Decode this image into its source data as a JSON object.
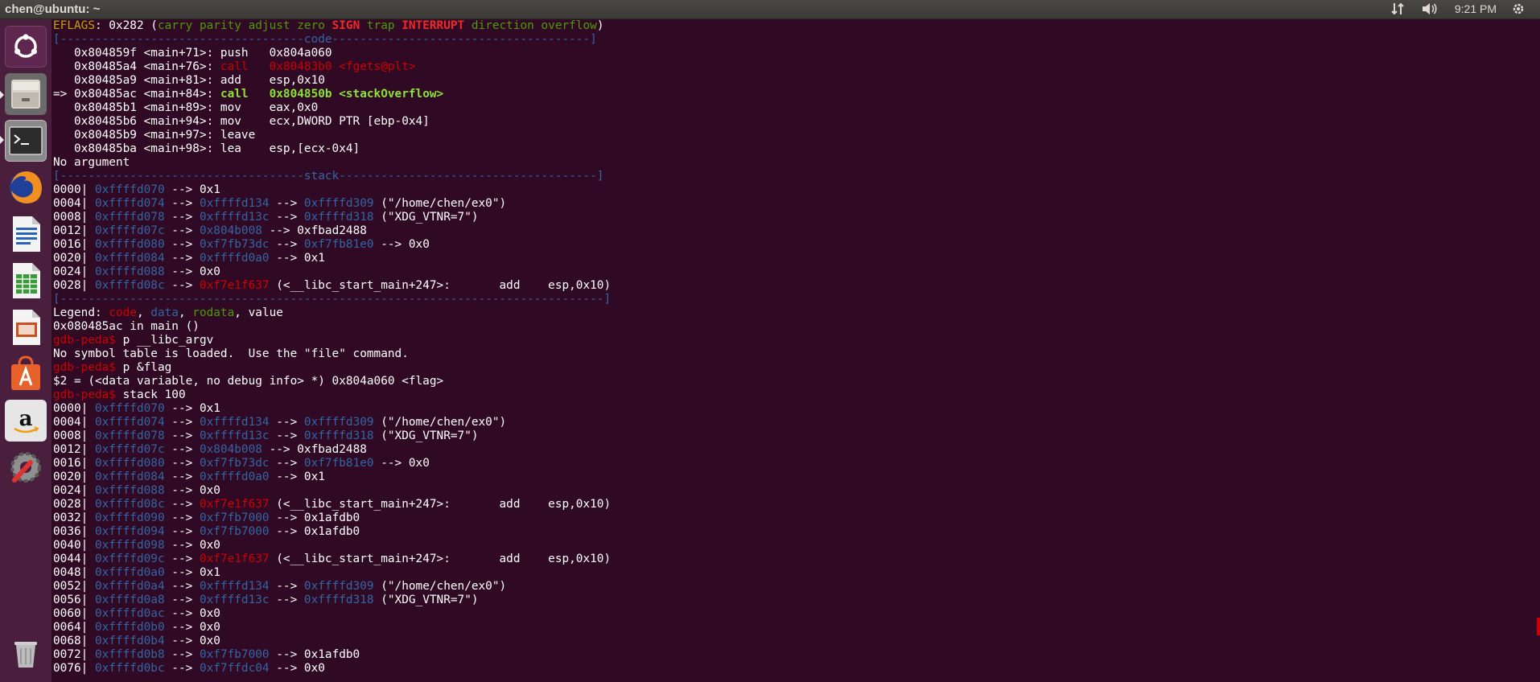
{
  "window": {
    "title": "chen@ubuntu: ~"
  },
  "tray": {
    "network_icon": "network-updown-icon",
    "volume_icon": "volume-icon",
    "clock": "9:21 PM",
    "settings_icon": "power-gear-icon"
  },
  "launcher": {
    "items": [
      {
        "name": "ubuntu-dash",
        "icon": "ubuntu-logo-icon"
      },
      {
        "name": "files",
        "icon": "file-cabinet-icon"
      },
      {
        "name": "terminal",
        "icon": "terminal-icon"
      },
      {
        "name": "firefox",
        "icon": "firefox-icon"
      },
      {
        "name": "libreoffice-writer",
        "icon": "writer-document-icon"
      },
      {
        "name": "libreoffice-calc",
        "icon": "calc-spreadsheet-icon"
      },
      {
        "name": "libreoffice-impress",
        "icon": "impress-presentation-icon"
      },
      {
        "name": "ubuntu-software",
        "icon": "software-center-bag-icon"
      },
      {
        "name": "amazon",
        "icon": "amazon-icon"
      },
      {
        "name": "system-settings",
        "icon": "settings-wrench-icon"
      },
      {
        "name": "trash",
        "icon": "trash-icon"
      }
    ]
  },
  "terminal": {
    "lines": [
      [
        [
          "y",
          "EFLAGS"
        ],
        [
          "w",
          ": 0x282 ("
        ],
        [
          "gg",
          "carry parity adjust zero "
        ],
        [
          "rb",
          "SIGN"
        ],
        [
          "gg",
          " trap "
        ],
        [
          "rb",
          "INTERRUPT"
        ],
        [
          "gg",
          " direction overflow"
        ],
        [
          "w",
          ")"
        ]
      ],
      [
        [
          "b",
          "[-----------------------------------code-------------------------------------]"
        ]
      ],
      [
        [
          "w",
          "   0x804859f <main+71>: push   0x804a060"
        ]
      ],
      [
        [
          "w",
          "   0x80485a4 <main+76>: "
        ],
        [
          "strike",
          "call   0x80483b0 <fgets@plt>"
        ]
      ],
      [
        [
          "w",
          "   0x80485a9 <main+81>: add    esp,0x10"
        ]
      ],
      [
        [
          "w",
          "=> 0x80485ac <main+84>: "
        ],
        [
          "gb",
          "call   0x804850b <stackOverflow>"
        ]
      ],
      [
        [
          "w",
          "   0x80485b1 <main+89>: mov    eax,0x0"
        ]
      ],
      [
        [
          "w",
          "   0x80485b6 <main+94>: mov    ecx,DWORD PTR [ebp-0x4]"
        ]
      ],
      [
        [
          "w",
          "   0x80485b9 <main+97>: leave"
        ]
      ],
      [
        [
          "w",
          "   0x80485ba <main+98>: lea    esp,[ecx-0x4]"
        ]
      ],
      [
        [
          "w",
          "No argument"
        ]
      ],
      [
        [
          "b",
          "[-----------------------------------stack-------------------------------------]"
        ]
      ],
      [
        [
          "w",
          "0000| "
        ],
        [
          "b",
          "0xffffd070"
        ],
        [
          "w",
          " --> 0x1"
        ]
      ],
      [
        [
          "w",
          "0004| "
        ],
        [
          "b",
          "0xffffd074"
        ],
        [
          "w",
          " --> "
        ],
        [
          "b",
          "0xffffd134"
        ],
        [
          "w",
          " --> "
        ],
        [
          "b",
          "0xffffd309"
        ],
        [
          "w",
          " (\"/home/chen/ex0\")"
        ]
      ],
      [
        [
          "w",
          "0008| "
        ],
        [
          "b",
          "0xffffd078"
        ],
        [
          "w",
          " --> "
        ],
        [
          "b",
          "0xffffd13c"
        ],
        [
          "w",
          " --> "
        ],
        [
          "b",
          "0xffffd318"
        ],
        [
          "w",
          " (\"XDG_VTNR=7\")"
        ]
      ],
      [
        [
          "w",
          "0012| "
        ],
        [
          "b",
          "0xffffd07c"
        ],
        [
          "w",
          " --> "
        ],
        [
          "b",
          "0x804b008"
        ],
        [
          "w",
          " --> 0xfbad2488"
        ]
      ],
      [
        [
          "w",
          "0016| "
        ],
        [
          "b",
          "0xffffd080"
        ],
        [
          "w",
          " --> "
        ],
        [
          "b",
          "0xf7fb73dc"
        ],
        [
          "w",
          " --> "
        ],
        [
          "b",
          "0xf7fb81e0"
        ],
        [
          "w",
          " --> 0x0"
        ]
      ],
      [
        [
          "w",
          "0020| "
        ],
        [
          "b",
          "0xffffd084"
        ],
        [
          "w",
          " --> "
        ],
        [
          "b",
          "0xffffd0a0"
        ],
        [
          "w",
          " --> 0x1"
        ]
      ],
      [
        [
          "w",
          "0024| "
        ],
        [
          "b",
          "0xffffd088"
        ],
        [
          "w",
          " --> 0x0"
        ]
      ],
      [
        [
          "w",
          "0028| "
        ],
        [
          "b",
          "0xffffd08c"
        ],
        [
          "w",
          " --> "
        ],
        [
          "r",
          "0xf7e1f637"
        ],
        [
          "w",
          " (<__libc_start_main+247>:       add    esp,0x10)"
        ]
      ],
      [
        [
          "b",
          "[------------------------------------------------------------------------------]"
        ]
      ],
      [
        [
          "w",
          "Legend: "
        ],
        [
          "r",
          "code"
        ],
        [
          "w",
          ", "
        ],
        [
          "b",
          "data"
        ],
        [
          "w",
          ", "
        ],
        [
          "gg",
          "rodata"
        ],
        [
          "w",
          ", value"
        ]
      ],
      [
        [
          "w",
          "0x080485ac in main ()"
        ]
      ],
      [
        [
          "r",
          "gdb-peda$"
        ],
        [
          "w",
          " p __libc_argv"
        ]
      ],
      [
        [
          "w",
          "No symbol table is loaded.  Use the \"file\" command."
        ]
      ],
      [
        [
          "r",
          "gdb-peda$"
        ],
        [
          "w",
          " p &flag"
        ]
      ],
      [
        [
          "w",
          "$2 = (<data variable, no debug info> *) 0x804a060 <flag>"
        ]
      ],
      [
        [
          "r",
          "gdb-peda$"
        ],
        [
          "w",
          " stack 100"
        ]
      ],
      [
        [
          "w",
          "0000| "
        ],
        [
          "b",
          "0xffffd070"
        ],
        [
          "w",
          " --> 0x1"
        ]
      ],
      [
        [
          "w",
          "0004| "
        ],
        [
          "b",
          "0xffffd074"
        ],
        [
          "w",
          " --> "
        ],
        [
          "b",
          "0xffffd134"
        ],
        [
          "w",
          " --> "
        ],
        [
          "b",
          "0xffffd309"
        ],
        [
          "w",
          " (\"/home/chen/ex0\")"
        ]
      ],
      [
        [
          "w",
          "0008| "
        ],
        [
          "b",
          "0xffffd078"
        ],
        [
          "w",
          " --> "
        ],
        [
          "b",
          "0xffffd13c"
        ],
        [
          "w",
          " --> "
        ],
        [
          "b",
          "0xffffd318"
        ],
        [
          "w",
          " (\"XDG_VTNR=7\")"
        ]
      ],
      [
        [
          "w",
          "0012| "
        ],
        [
          "b",
          "0xffffd07c"
        ],
        [
          "w",
          " --> "
        ],
        [
          "b",
          "0x804b008"
        ],
        [
          "w",
          " --> 0xfbad2488"
        ]
      ],
      [
        [
          "w",
          "0016| "
        ],
        [
          "b",
          "0xffffd080"
        ],
        [
          "w",
          " --> "
        ],
        [
          "b",
          "0xf7fb73dc"
        ],
        [
          "w",
          " --> "
        ],
        [
          "b",
          "0xf7fb81e0"
        ],
        [
          "w",
          " --> 0x0"
        ]
      ],
      [
        [
          "w",
          "0020| "
        ],
        [
          "b",
          "0xffffd084"
        ],
        [
          "w",
          " --> "
        ],
        [
          "b",
          "0xffffd0a0"
        ],
        [
          "w",
          " --> 0x1"
        ]
      ],
      [
        [
          "w",
          "0024| "
        ],
        [
          "b",
          "0xffffd088"
        ],
        [
          "w",
          " --> 0x0"
        ]
      ],
      [
        [
          "w",
          "0028| "
        ],
        [
          "b",
          "0xffffd08c"
        ],
        [
          "w",
          " --> "
        ],
        [
          "r",
          "0xf7e1f637"
        ],
        [
          "w",
          " (<__libc_start_main+247>:       add    esp,0x10)"
        ]
      ],
      [
        [
          "w",
          "0032| "
        ],
        [
          "b",
          "0xffffd090"
        ],
        [
          "w",
          " --> "
        ],
        [
          "b",
          "0xf7fb7000"
        ],
        [
          "w",
          " --> 0x1afdb0"
        ]
      ],
      [
        [
          "w",
          "0036| "
        ],
        [
          "b",
          "0xffffd094"
        ],
        [
          "w",
          " --> "
        ],
        [
          "b",
          "0xf7fb7000"
        ],
        [
          "w",
          " --> 0x1afdb0"
        ]
      ],
      [
        [
          "w",
          "0040| "
        ],
        [
          "b",
          "0xffffd098"
        ],
        [
          "w",
          " --> 0x0"
        ]
      ],
      [
        [
          "w",
          "0044| "
        ],
        [
          "b",
          "0xffffd09c"
        ],
        [
          "w",
          " --> "
        ],
        [
          "r",
          "0xf7e1f637"
        ],
        [
          "w",
          " (<__libc_start_main+247>:       add    esp,0x10)"
        ]
      ],
      [
        [
          "w",
          "0048| "
        ],
        [
          "b",
          "0xffffd0a0"
        ],
        [
          "w",
          " --> 0x1"
        ]
      ],
      [
        [
          "w",
          "0052| "
        ],
        [
          "b",
          "0xffffd0a4"
        ],
        [
          "w",
          " --> "
        ],
        [
          "b",
          "0xffffd134"
        ],
        [
          "w",
          " --> "
        ],
        [
          "b",
          "0xffffd309"
        ],
        [
          "w",
          " (\"/home/chen/ex0\")"
        ]
      ],
      [
        [
          "w",
          "0056| "
        ],
        [
          "b",
          "0xffffd0a8"
        ],
        [
          "w",
          " --> "
        ],
        [
          "b",
          "0xffffd13c"
        ],
        [
          "w",
          " --> "
        ],
        [
          "b",
          "0xffffd318"
        ],
        [
          "w",
          " (\"XDG_VTNR=7\")"
        ]
      ],
      [
        [
          "w",
          "0060| "
        ],
        [
          "b",
          "0xffffd0ac"
        ],
        [
          "w",
          " --> 0x0"
        ]
      ],
      [
        [
          "w",
          "0064| "
        ],
        [
          "b",
          "0xffffd0b0"
        ],
        [
          "w",
          " --> 0x0"
        ]
      ],
      [
        [
          "w",
          "0068| "
        ],
        [
          "b",
          "0xffffd0b4"
        ],
        [
          "w",
          " --> 0x0"
        ]
      ],
      [
        [
          "w",
          "0072| "
        ],
        [
          "b",
          "0xffffd0b8"
        ],
        [
          "w",
          " --> "
        ],
        [
          "b",
          "0xf7fb7000"
        ],
        [
          "w",
          " --> 0x1afdb0"
        ]
      ],
      [
        [
          "w",
          "0076| "
        ],
        [
          "b",
          "0xffffd0bc"
        ],
        [
          "w",
          " --> "
        ],
        [
          "b",
          "0xf7ffdc04"
        ],
        [
          "w",
          " --> 0x0"
        ]
      ]
    ]
  }
}
